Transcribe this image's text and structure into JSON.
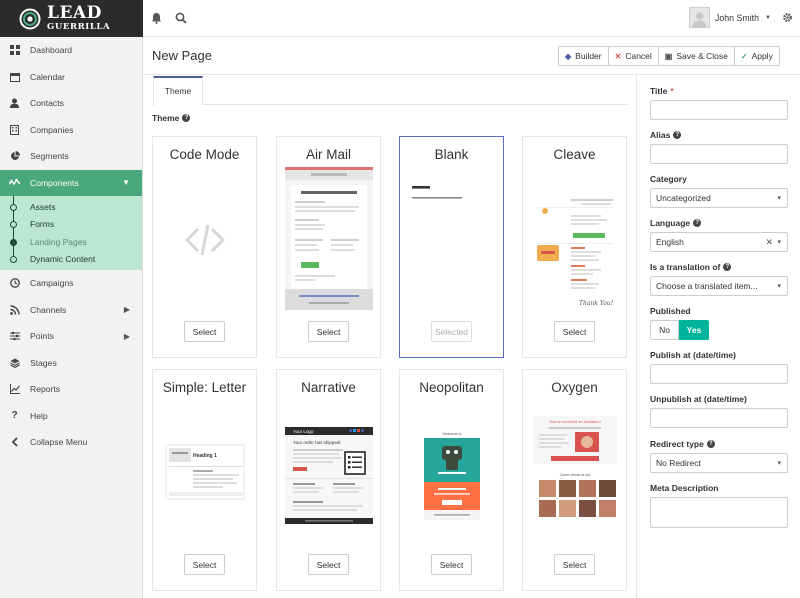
{
  "brand": {
    "line1": "LEAD",
    "line2": "GUERRILLA",
    "logo_icon": "target-spiral-icon"
  },
  "topbar": {
    "bell_icon": "bell-icon",
    "search_icon": "search-icon",
    "user_name": "John Smith",
    "settings_icon": "gear-icon"
  },
  "sidebar": {
    "items": [
      {
        "label": "Dashboard",
        "icon": "dashboard-icon"
      },
      {
        "label": "Calendar",
        "icon": "calendar-icon"
      },
      {
        "label": "Contacts",
        "icon": "user-icon"
      },
      {
        "label": "Companies",
        "icon": "building-icon"
      },
      {
        "label": "Segments",
        "icon": "pie-chart-icon"
      },
      {
        "label": "Components",
        "icon": "puzzle-icon",
        "active": true
      },
      {
        "label": "Campaigns",
        "icon": "clock-icon"
      },
      {
        "label": "Channels",
        "icon": "rss-icon"
      },
      {
        "label": "Points",
        "icon": "sliders-icon"
      },
      {
        "label": "Stages",
        "icon": "layers-icon"
      },
      {
        "label": "Reports",
        "icon": "line-chart-icon"
      },
      {
        "label": "Help",
        "icon": "question-icon"
      },
      {
        "label": "Collapse Menu",
        "icon": "chevron-left-icon"
      }
    ],
    "sub_items": [
      {
        "label": "Assets"
      },
      {
        "label": "Forms"
      },
      {
        "label": "Landing Pages",
        "current": true
      },
      {
        "label": "Dynamic Content"
      }
    ]
  },
  "header": {
    "title": "New Page",
    "buttons": [
      {
        "label": "Builder",
        "icon": "cube-icon",
        "color": "#4e5d9d"
      },
      {
        "label": "Cancel",
        "icon": "close-icon",
        "color": "#d9534f"
      },
      {
        "label": "Save & Close",
        "icon": "save-icon",
        "color": "#555555"
      },
      {
        "label": "Apply",
        "icon": "check-icon",
        "color": "#4aa87e"
      }
    ]
  },
  "tabs": [
    {
      "label": "Theme"
    }
  ],
  "theme_label": "Theme",
  "themes": [
    {
      "name": "Code Mode",
      "button": "Select"
    },
    {
      "name": "Air Mail",
      "button": "Select"
    },
    {
      "name": "Blank",
      "button": "Selected",
      "selected": true
    },
    {
      "name": "Cleave",
      "button": "Select"
    },
    {
      "name": "Simple: Letter",
      "button": "Select"
    },
    {
      "name": "Narrative",
      "button": "Select"
    },
    {
      "name": "Neopolitan",
      "button": "Select"
    },
    {
      "name": "Oxygen",
      "button": "Select"
    }
  ],
  "previews": {
    "airmail": {
      "heading": "Company Name",
      "line": "Your order has been shipped!"
    },
    "blank": {
      "heading": "Hello there!",
      "line": "We haven't heard from you for a while..."
    },
    "cleave": {
      "script": "Thank You!"
    },
    "letter": {
      "heading": "Heading 1"
    },
    "narrative": {
      "logo": "Your Logo",
      "line": "Your order has shipped!"
    },
    "neopolitan": {
      "line": "Welcome to"
    },
    "oxygen": {
      "heading": "You've received an invitation!",
      "sub": "Come check us out"
    }
  },
  "form": {
    "title_label": "Title",
    "title_required": "*",
    "alias_label": "Alias",
    "category_label": "Category",
    "category_value": "Uncategorized",
    "language_label": "Language",
    "language_value": "English",
    "translation_label": "Is a translation of",
    "translation_placeholder": "Choose a translated item...",
    "published_label": "Published",
    "published_no": "No",
    "published_yes": "Yes",
    "publish_at_label": "Publish at (date/time)",
    "unpublish_at_label": "Unpublish at (date/time)",
    "redirect_label": "Redirect type",
    "redirect_value": "No Redirect",
    "meta_label": "Meta Description"
  },
  "colors": {
    "accent": "#4aa87e",
    "sidebar_sub": "#bce5d2",
    "yes_toggle": "#00b49c",
    "selected_border": "#5c6ac4"
  }
}
